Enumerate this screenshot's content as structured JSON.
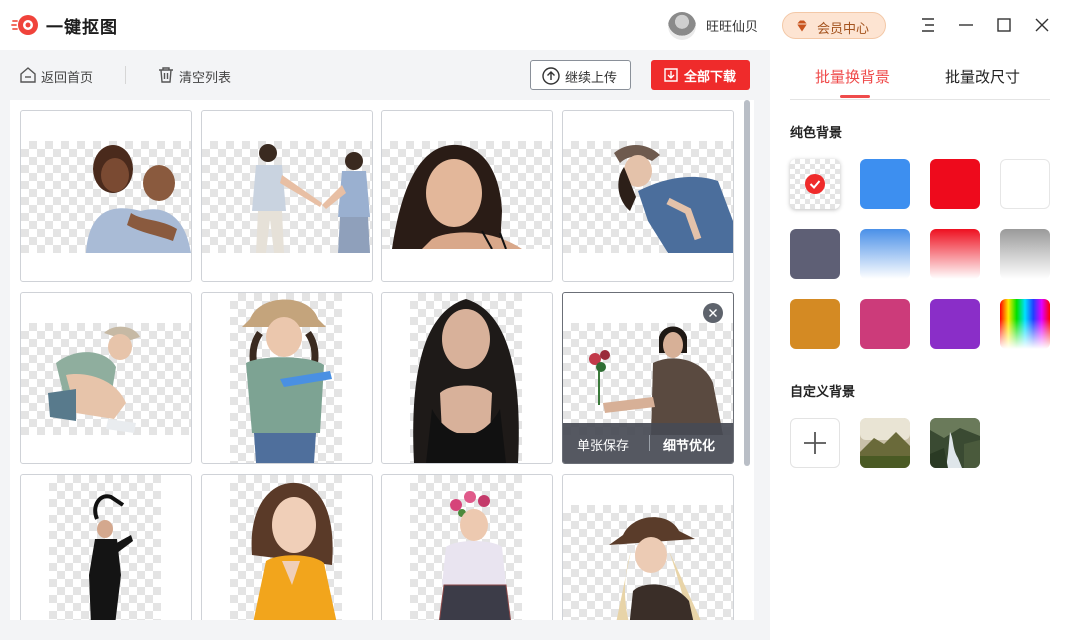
{
  "app": {
    "title": "一键抠图",
    "username": "旺旺仙贝",
    "vip_label": "会员中心",
    "accent_color": "#ef2b2b"
  },
  "window_controls": [
    "menu-icon",
    "minimize-icon",
    "maximize-icon",
    "close-icon"
  ],
  "toolbar": {
    "back_label": "返回首页",
    "clear_label": "清空列表",
    "upload_label": "继续上传",
    "download_label": "全部下载"
  },
  "grid": {
    "selected_card_actions": {
      "save_single": "单张保存",
      "refine": "细节优化"
    }
  },
  "right_panel": {
    "tabs": [
      {
        "label": "批量换背景",
        "active": true
      },
      {
        "label": "批量改尺寸",
        "active": false
      }
    ],
    "solid_bg_title": "纯色背景",
    "custom_bg_title": "自定义背景",
    "solid_colors": [
      {
        "name": "transparent",
        "value": "checker",
        "selected": true
      },
      {
        "name": "blue",
        "value": "#3d8ff0"
      },
      {
        "name": "red",
        "value": "#ee0a1c"
      },
      {
        "name": "white",
        "value": "#ffffff"
      },
      {
        "name": "slate",
        "value": "#5e5f75"
      },
      {
        "name": "blue-gradient",
        "value": "linear-gradient(#4a90e8,#ffffff)"
      },
      {
        "name": "red-gradient",
        "value": "linear-gradient(#ee1020,#ffffff)"
      },
      {
        "name": "gray-gradient",
        "value": "linear-gradient(#9a9a9a,#ffffff)"
      },
      {
        "name": "orange",
        "value": "#d48a23"
      },
      {
        "name": "pink",
        "value": "#cc3b7a"
      },
      {
        "name": "purple",
        "value": "#8a2ec8"
      },
      {
        "name": "rainbow",
        "value": "rainbow"
      }
    ],
    "custom_backgrounds": [
      "add-background",
      "mountain-landscape",
      "waterfall-landscape"
    ]
  }
}
